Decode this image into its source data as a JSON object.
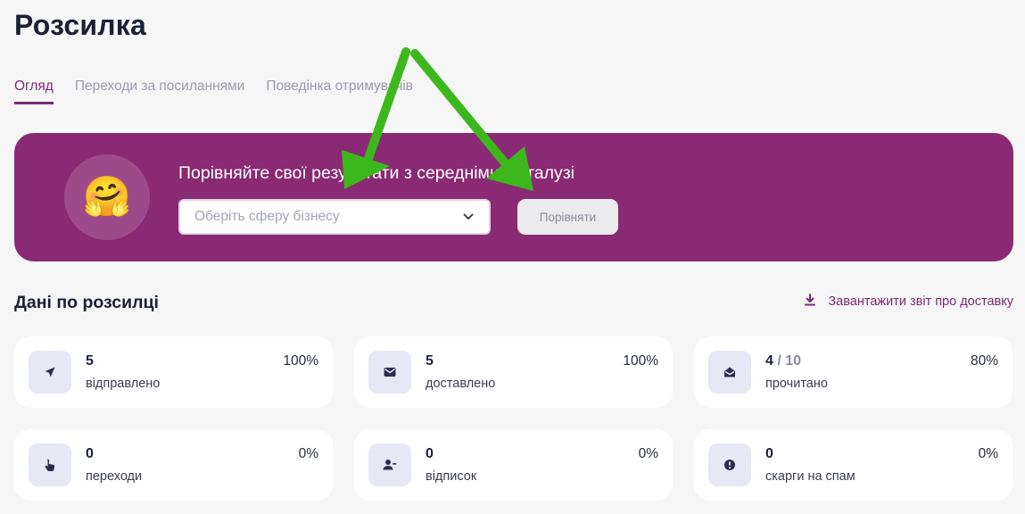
{
  "page": {
    "title": "Розсилка"
  },
  "tabs": [
    {
      "label": "Огляд",
      "active": true
    },
    {
      "label": "Переходи за посиланнями",
      "active": false
    },
    {
      "label": "Поведінка отримувачів",
      "active": false
    }
  ],
  "banner": {
    "text": "Порівняйте свої результати з середніми по галузі",
    "emoji": "🤗",
    "select_placeholder": "Оберіть сферу бізнесу",
    "compare_button": "Порівняти",
    "background": "#8a2974"
  },
  "section": {
    "title": "Дані по розсилці",
    "download_label": "Завантажити звіт про доставку"
  },
  "stats": [
    {
      "icon": "send-icon",
      "value": "5",
      "total": "",
      "label": "відправлено",
      "percent": "100%"
    },
    {
      "icon": "envelope-icon",
      "value": "5",
      "total": "",
      "label": "доставлено",
      "percent": "100%"
    },
    {
      "icon": "envelope-open-icon",
      "value": "4",
      "total": " / 10",
      "label": "прочитано",
      "percent": "80%"
    },
    {
      "icon": "pointer-hand-icon",
      "value": "0",
      "total": "",
      "label": "переходи",
      "percent": "0%"
    },
    {
      "icon": "user-minus-icon",
      "value": "0",
      "total": "",
      "label": "відписок",
      "percent": "0%"
    },
    {
      "icon": "alert-circle-icon",
      "value": "0",
      "total": "",
      "label": "скарги на спам",
      "percent": "0%"
    }
  ],
  "colors": {
    "accent": "#7b2a73",
    "icon": "#2a2f4f",
    "annotation_arrow": "#3cb81c"
  }
}
